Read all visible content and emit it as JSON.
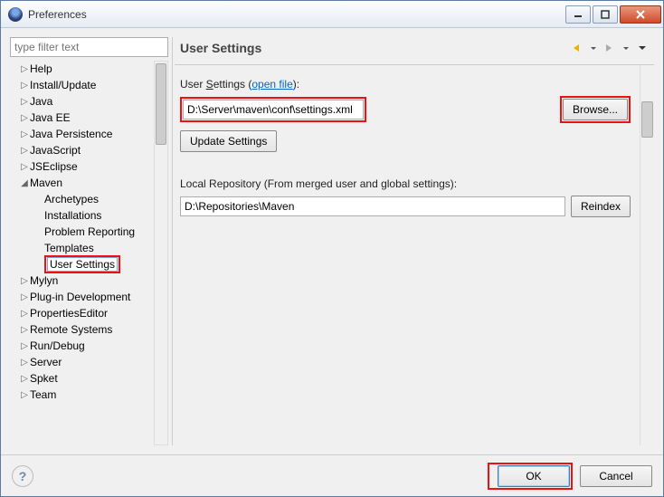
{
  "window": {
    "title": "Preferences"
  },
  "filter": {
    "placeholder": "type filter text"
  },
  "tree": {
    "items": [
      {
        "label": "Help",
        "depth": 0,
        "expand": "▷"
      },
      {
        "label": "Install/Update",
        "depth": 0,
        "expand": "▷"
      },
      {
        "label": "Java",
        "depth": 0,
        "expand": "▷"
      },
      {
        "label": "Java EE",
        "depth": 0,
        "expand": "▷"
      },
      {
        "label": "Java Persistence",
        "depth": 0,
        "expand": "▷"
      },
      {
        "label": "JavaScript",
        "depth": 0,
        "expand": "▷"
      },
      {
        "label": "JSEclipse",
        "depth": 0,
        "expand": "▷"
      },
      {
        "label": "Maven",
        "depth": 0,
        "expand": "◢"
      },
      {
        "label": "Archetypes",
        "depth": 1,
        "expand": ""
      },
      {
        "label": "Installations",
        "depth": 1,
        "expand": ""
      },
      {
        "label": "Problem Reporting",
        "depth": 1,
        "expand": ""
      },
      {
        "label": "Templates",
        "depth": 1,
        "expand": ""
      },
      {
        "label": "User Settings",
        "depth": 1,
        "expand": "",
        "selected": true,
        "highlight": true
      },
      {
        "label": "Mylyn",
        "depth": 0,
        "expand": "▷"
      },
      {
        "label": "Plug-in Development",
        "depth": 0,
        "expand": "▷"
      },
      {
        "label": "PropertiesEditor",
        "depth": 0,
        "expand": "▷"
      },
      {
        "label": "Remote Systems",
        "depth": 0,
        "expand": "▷"
      },
      {
        "label": "Run/Debug",
        "depth": 0,
        "expand": "▷"
      },
      {
        "label": "Server",
        "depth": 0,
        "expand": "▷"
      },
      {
        "label": "Spket",
        "depth": 0,
        "expand": "▷"
      },
      {
        "label": "Team",
        "depth": 0,
        "expand": "▷"
      }
    ]
  },
  "page": {
    "title": "User Settings",
    "userSettingsLabelPrefix": "User ",
    "userSettingsLabelU": "S",
    "userSettingsLabelSuffix": "ettings (",
    "openFile": "open file",
    "userSettingsLabelEnd": "):",
    "userSettingsValue": "D:\\Server\\maven\\conf\\settings.xml",
    "browse": "Browse...",
    "updateSettings": "Update Settings",
    "localRepoLabel": "Local Repository (From merged user and global settings):",
    "localRepoValue": "D:\\Repositories\\Maven",
    "reindex": "Reindex"
  },
  "footer": {
    "ok": "OK",
    "cancel": "Cancel",
    "help": "?"
  }
}
